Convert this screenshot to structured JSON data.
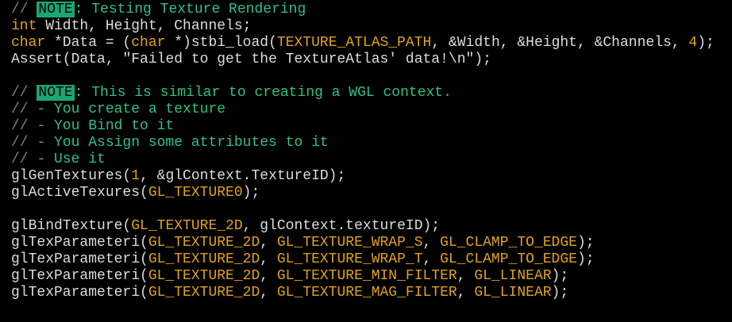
{
  "colors": {
    "background": "#000000",
    "text": "#dcdcdc",
    "comment": "#2fbf8c",
    "comment_slash": "#7f7f7f",
    "keyword": "#e1a21b",
    "note_badge_bg": "#1aa673"
  },
  "code_lines": [
    [
      {
        "t": "// ",
        "k": "comment-slash"
      },
      {
        "t": "NOTE",
        "k": "note"
      },
      {
        "t": ": Testing Texture Rendering",
        "k": "comment"
      }
    ],
    [
      {
        "t": "int",
        "k": "keyword"
      },
      {
        "t": " Width, Height, Channels;",
        "k": "default"
      }
    ],
    [
      {
        "t": "char",
        "k": "keyword"
      },
      {
        "t": " *Data = (",
        "k": "default"
      },
      {
        "t": "char",
        "k": "keyword"
      },
      {
        "t": " *)stbi_load(",
        "k": "default"
      },
      {
        "t": "TEXTURE_ATLAS_PATH",
        "k": "macro"
      },
      {
        "t": ", &Width, &Height, &Channels, ",
        "k": "default"
      },
      {
        "t": "4",
        "k": "number"
      },
      {
        "t": ");",
        "k": "default"
      }
    ],
    [
      {
        "t": "Assert(Data, ",
        "k": "default"
      },
      {
        "t": "\"Failed to get the TextureAtlas' data!\\n\"",
        "k": "string"
      },
      {
        "t": ");",
        "k": "default"
      }
    ],
    [],
    [
      {
        "t": "// ",
        "k": "comment-slash"
      },
      {
        "t": "NOTE",
        "k": "note"
      },
      {
        "t": ": This is similar to creating a WGL context.",
        "k": "comment"
      }
    ],
    [
      {
        "t": "// ",
        "k": "comment-slash"
      },
      {
        "t": "- You create a texture",
        "k": "comment"
      }
    ],
    [
      {
        "t": "// ",
        "k": "comment-slash"
      },
      {
        "t": "- You Bind to it",
        "k": "comment"
      }
    ],
    [
      {
        "t": "// ",
        "k": "comment-slash"
      },
      {
        "t": "- You Assign some attributes to it",
        "k": "comment"
      }
    ],
    [
      {
        "t": "// ",
        "k": "comment-slash"
      },
      {
        "t": "- Use it",
        "k": "comment"
      }
    ],
    [
      {
        "t": "glGenTextures(",
        "k": "default"
      },
      {
        "t": "1",
        "k": "number"
      },
      {
        "t": ", &glContext.TextureID);",
        "k": "default"
      }
    ],
    [
      {
        "t": "glActiveTexures(",
        "k": "default"
      },
      {
        "t": "GL_TEXTURE0",
        "k": "macro"
      },
      {
        "t": ");",
        "k": "default"
      }
    ],
    [],
    [
      {
        "t": "glBindTexture(",
        "k": "default"
      },
      {
        "t": "GL_TEXTURE_2D",
        "k": "macro"
      },
      {
        "t": ", glContext.textureID);",
        "k": "default"
      }
    ],
    [
      {
        "t": "glTexParameteri(",
        "k": "default"
      },
      {
        "t": "GL_TEXTURE_2D",
        "k": "macro"
      },
      {
        "t": ", ",
        "k": "default"
      },
      {
        "t": "GL_TEXTURE_WRAP_S",
        "k": "macro"
      },
      {
        "t": ", ",
        "k": "default"
      },
      {
        "t": "GL_CLAMP_TO_EDGE",
        "k": "macro"
      },
      {
        "t": ");",
        "k": "default"
      }
    ],
    [
      {
        "t": "glTexParameteri(",
        "k": "default"
      },
      {
        "t": "GL_TEXTURE_2D",
        "k": "macro"
      },
      {
        "t": ", ",
        "k": "default"
      },
      {
        "t": "GL_TEXTURE_WRAP_T",
        "k": "macro"
      },
      {
        "t": ", ",
        "k": "default"
      },
      {
        "t": "GL_CLAMP_TO_EDGE",
        "k": "macro"
      },
      {
        "t": ");",
        "k": "default"
      }
    ],
    [
      {
        "t": "glTexParameteri(",
        "k": "default"
      },
      {
        "t": "GL_TEXTURE_2D",
        "k": "macro"
      },
      {
        "t": ", ",
        "k": "default"
      },
      {
        "t": "GL_TEXTURE_MIN_FILTER",
        "k": "macro"
      },
      {
        "t": ", ",
        "k": "default"
      },
      {
        "t": "GL_LINEAR",
        "k": "macro"
      },
      {
        "t": ");",
        "k": "default"
      }
    ],
    [
      {
        "t": "glTexParameteri(",
        "k": "default"
      },
      {
        "t": "GL_TEXTURE_2D",
        "k": "macro"
      },
      {
        "t": ", ",
        "k": "default"
      },
      {
        "t": "GL_TEXTURE_MAG_FILTER",
        "k": "macro"
      },
      {
        "t": ", ",
        "k": "default"
      },
      {
        "t": "GL_LINEAR",
        "k": "macro"
      },
      {
        "t": ");",
        "k": "default"
      }
    ]
  ]
}
